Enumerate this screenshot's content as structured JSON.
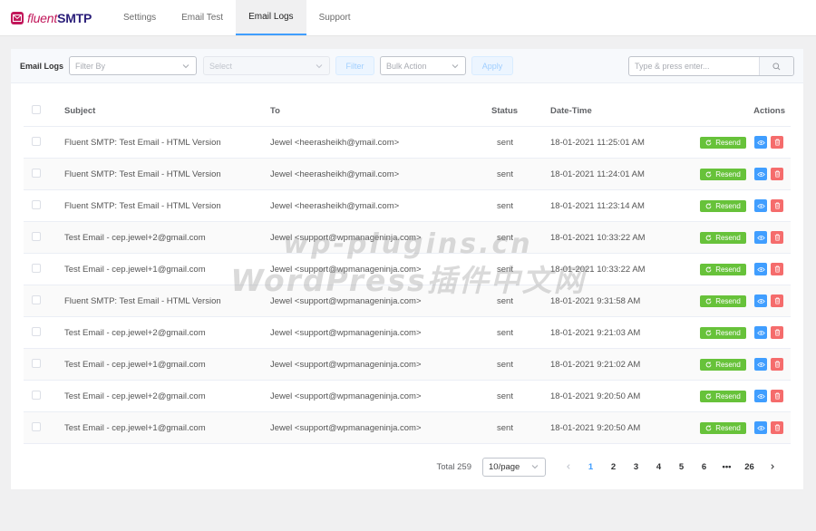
{
  "brand": {
    "name_light": "fluent",
    "name_bold": "SMTP"
  },
  "nav": [
    {
      "label": "Settings",
      "active": false
    },
    {
      "label": "Email Test",
      "active": false
    },
    {
      "label": "Email Logs",
      "active": true
    },
    {
      "label": "Support",
      "active": false
    }
  ],
  "toolbar": {
    "label": "Email Logs",
    "filter_placeholder": "Filter By",
    "select_placeholder": "Select",
    "filter_button": "Filter",
    "bulk_placeholder": "Bulk Action",
    "apply_button": "Apply",
    "search_placeholder": "Type & press enter..."
  },
  "table": {
    "headers": {
      "subject": "Subject",
      "to": "To",
      "status": "Status",
      "datetime": "Date-Time",
      "actions": "Actions"
    },
    "resend_label": "Resend",
    "rows": [
      {
        "subject": "Fluent SMTP: Test Email - HTML Version",
        "to": "Jewel <heerasheikh@ymail.com>",
        "status": "sent",
        "datetime": "18-01-2021 11:25:01 AM"
      },
      {
        "subject": "Fluent SMTP: Test Email - HTML Version",
        "to": "Jewel <heerasheikh@ymail.com>",
        "status": "sent",
        "datetime": "18-01-2021 11:24:01 AM"
      },
      {
        "subject": "Fluent SMTP: Test Email - HTML Version",
        "to": "Jewel <heerasheikh@ymail.com>",
        "status": "sent",
        "datetime": "18-01-2021 11:23:14 AM"
      },
      {
        "subject": "Test Email - cep.jewel+2@gmail.com",
        "to": "Jewel <support@wpmanageninja.com>",
        "status": "sent",
        "datetime": "18-01-2021 10:33:22 AM"
      },
      {
        "subject": "Test Email - cep.jewel+1@gmail.com",
        "to": "Jewel <support@wpmanageninja.com>",
        "status": "sent",
        "datetime": "18-01-2021 10:33:22 AM"
      },
      {
        "subject": "Fluent SMTP: Test Email - HTML Version",
        "to": "Jewel <support@wpmanageninja.com>",
        "status": "sent",
        "datetime": "18-01-2021 9:31:58 AM"
      },
      {
        "subject": "Test Email - cep.jewel+2@gmail.com",
        "to": "Jewel <support@wpmanageninja.com>",
        "status": "sent",
        "datetime": "18-01-2021 9:21:03 AM"
      },
      {
        "subject": "Test Email - cep.jewel+1@gmail.com",
        "to": "Jewel <support@wpmanageninja.com>",
        "status": "sent",
        "datetime": "18-01-2021 9:21:02 AM"
      },
      {
        "subject": "Test Email - cep.jewel+2@gmail.com",
        "to": "Jewel <support@wpmanageninja.com>",
        "status": "sent",
        "datetime": "18-01-2021 9:20:50 AM"
      },
      {
        "subject": "Test Email - cep.jewel+1@gmail.com",
        "to": "Jewel <support@wpmanageninja.com>",
        "status": "sent",
        "datetime": "18-01-2021 9:20:50 AM"
      }
    ]
  },
  "pagination": {
    "total_label": "Total 259",
    "page_size": "10/page",
    "pages": [
      "1",
      "2",
      "3",
      "4",
      "5",
      "6",
      "•••",
      "26"
    ],
    "current": "1"
  },
  "watermark": {
    "line1": "wp-plugins.cn",
    "line2": "WordPress插件中文网"
  },
  "colors": {
    "primary": "#409eff",
    "success": "#67c23a",
    "danger": "#f56c6c",
    "brand": "#c2185b"
  }
}
